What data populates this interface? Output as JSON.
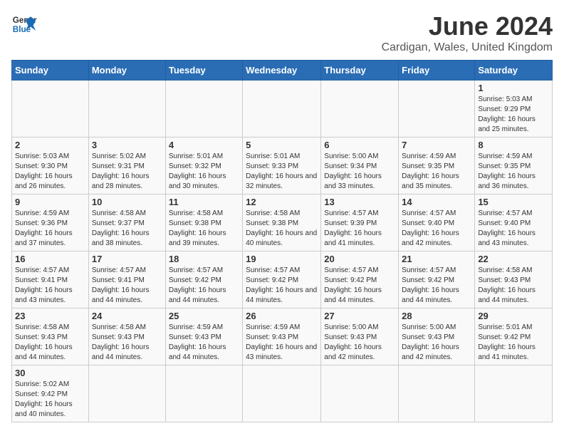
{
  "header": {
    "logo_general": "General",
    "logo_blue": "Blue",
    "title": "June 2024",
    "subtitle": "Cardigan, Wales, United Kingdom"
  },
  "days_of_week": [
    "Sunday",
    "Monday",
    "Tuesday",
    "Wednesday",
    "Thursday",
    "Friday",
    "Saturday"
  ],
  "weeks": [
    [
      {
        "day": "",
        "info": ""
      },
      {
        "day": "",
        "info": ""
      },
      {
        "day": "",
        "info": ""
      },
      {
        "day": "",
        "info": ""
      },
      {
        "day": "",
        "info": ""
      },
      {
        "day": "",
        "info": ""
      },
      {
        "day": "1",
        "info": "Sunrise: 5:03 AM\nSunset: 9:29 PM\nDaylight: 16 hours and 25 minutes."
      }
    ],
    [
      {
        "day": "2",
        "info": "Sunrise: 5:03 AM\nSunset: 9:30 PM\nDaylight: 16 hours and 26 minutes."
      },
      {
        "day": "3",
        "info": "Sunrise: 5:02 AM\nSunset: 9:31 PM\nDaylight: 16 hours and 28 minutes."
      },
      {
        "day": "4",
        "info": "Sunrise: 5:01 AM\nSunset: 9:32 PM\nDaylight: 16 hours and 30 minutes."
      },
      {
        "day": "5",
        "info": "Sunrise: 5:01 AM\nSunset: 9:33 PM\nDaylight: 16 hours and 32 minutes."
      },
      {
        "day": "6",
        "info": "Sunrise: 5:00 AM\nSunset: 9:34 PM\nDaylight: 16 hours and 33 minutes."
      },
      {
        "day": "7",
        "info": "Sunrise: 4:59 AM\nSunset: 9:35 PM\nDaylight: 16 hours and 35 minutes."
      },
      {
        "day": "8",
        "info": "Sunrise: 4:59 AM\nSunset: 9:35 PM\nDaylight: 16 hours and 36 minutes."
      }
    ],
    [
      {
        "day": "9",
        "info": "Sunrise: 4:59 AM\nSunset: 9:36 PM\nDaylight: 16 hours and 37 minutes."
      },
      {
        "day": "10",
        "info": "Sunrise: 4:58 AM\nSunset: 9:37 PM\nDaylight: 16 hours and 38 minutes."
      },
      {
        "day": "11",
        "info": "Sunrise: 4:58 AM\nSunset: 9:38 PM\nDaylight: 16 hours and 39 minutes."
      },
      {
        "day": "12",
        "info": "Sunrise: 4:58 AM\nSunset: 9:38 PM\nDaylight: 16 hours and 40 minutes."
      },
      {
        "day": "13",
        "info": "Sunrise: 4:57 AM\nSunset: 9:39 PM\nDaylight: 16 hours and 41 minutes."
      },
      {
        "day": "14",
        "info": "Sunrise: 4:57 AM\nSunset: 9:40 PM\nDaylight: 16 hours and 42 minutes."
      },
      {
        "day": "15",
        "info": "Sunrise: 4:57 AM\nSunset: 9:40 PM\nDaylight: 16 hours and 43 minutes."
      }
    ],
    [
      {
        "day": "16",
        "info": "Sunrise: 4:57 AM\nSunset: 9:41 PM\nDaylight: 16 hours and 43 minutes."
      },
      {
        "day": "17",
        "info": "Sunrise: 4:57 AM\nSunset: 9:41 PM\nDaylight: 16 hours and 44 minutes."
      },
      {
        "day": "18",
        "info": "Sunrise: 4:57 AM\nSunset: 9:42 PM\nDaylight: 16 hours and 44 minutes."
      },
      {
        "day": "19",
        "info": "Sunrise: 4:57 AM\nSunset: 9:42 PM\nDaylight: 16 hours and 44 minutes."
      },
      {
        "day": "20",
        "info": "Sunrise: 4:57 AM\nSunset: 9:42 PM\nDaylight: 16 hours and 44 minutes."
      },
      {
        "day": "21",
        "info": "Sunrise: 4:57 AM\nSunset: 9:42 PM\nDaylight: 16 hours and 44 minutes."
      },
      {
        "day": "22",
        "info": "Sunrise: 4:58 AM\nSunset: 9:43 PM\nDaylight: 16 hours and 44 minutes."
      }
    ],
    [
      {
        "day": "23",
        "info": "Sunrise: 4:58 AM\nSunset: 9:43 PM\nDaylight: 16 hours and 44 minutes."
      },
      {
        "day": "24",
        "info": "Sunrise: 4:58 AM\nSunset: 9:43 PM\nDaylight: 16 hours and 44 minutes."
      },
      {
        "day": "25",
        "info": "Sunrise: 4:59 AM\nSunset: 9:43 PM\nDaylight: 16 hours and 44 minutes."
      },
      {
        "day": "26",
        "info": "Sunrise: 4:59 AM\nSunset: 9:43 PM\nDaylight: 16 hours and 43 minutes."
      },
      {
        "day": "27",
        "info": "Sunrise: 5:00 AM\nSunset: 9:43 PM\nDaylight: 16 hours and 42 minutes."
      },
      {
        "day": "28",
        "info": "Sunrise: 5:00 AM\nSunset: 9:43 PM\nDaylight: 16 hours and 42 minutes."
      },
      {
        "day": "29",
        "info": "Sunrise: 5:01 AM\nSunset: 9:42 PM\nDaylight: 16 hours and 41 minutes."
      }
    ],
    [
      {
        "day": "30",
        "info": "Sunrise: 5:02 AM\nSunset: 9:42 PM\nDaylight: 16 hours and 40 minutes."
      },
      {
        "day": "",
        "info": ""
      },
      {
        "day": "",
        "info": ""
      },
      {
        "day": "",
        "info": ""
      },
      {
        "day": "",
        "info": ""
      },
      {
        "day": "",
        "info": ""
      },
      {
        "day": "",
        "info": ""
      }
    ]
  ]
}
